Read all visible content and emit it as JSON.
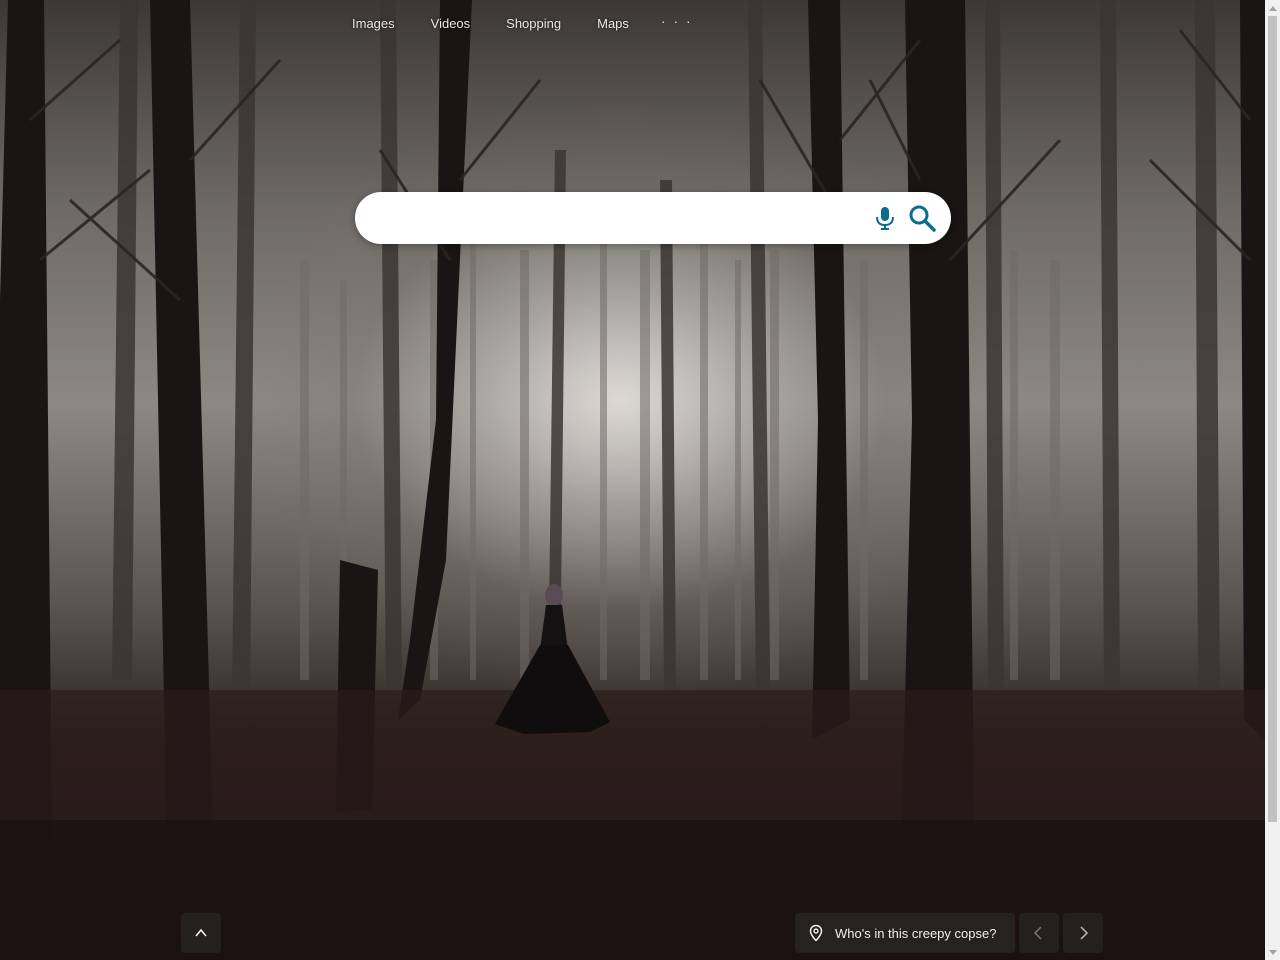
{
  "nav": {
    "items": [
      {
        "label": "Images"
      },
      {
        "label": "Videos"
      },
      {
        "label": "Shopping"
      },
      {
        "label": "Maps"
      }
    ],
    "more_label": "· · ·"
  },
  "search": {
    "value": "",
    "placeholder": ""
  },
  "footer": {
    "image_caption": "Who's in this creepy copse?"
  },
  "colors": {
    "accent": "#0c6b8e",
    "pill_bg": "#282626"
  },
  "icons": {
    "mic": "microphone-icon",
    "search": "search-icon",
    "scroll_top": "chevron-up-icon",
    "location": "location-pin-icon",
    "prev": "chevron-left-icon",
    "next": "chevron-right-icon"
  }
}
